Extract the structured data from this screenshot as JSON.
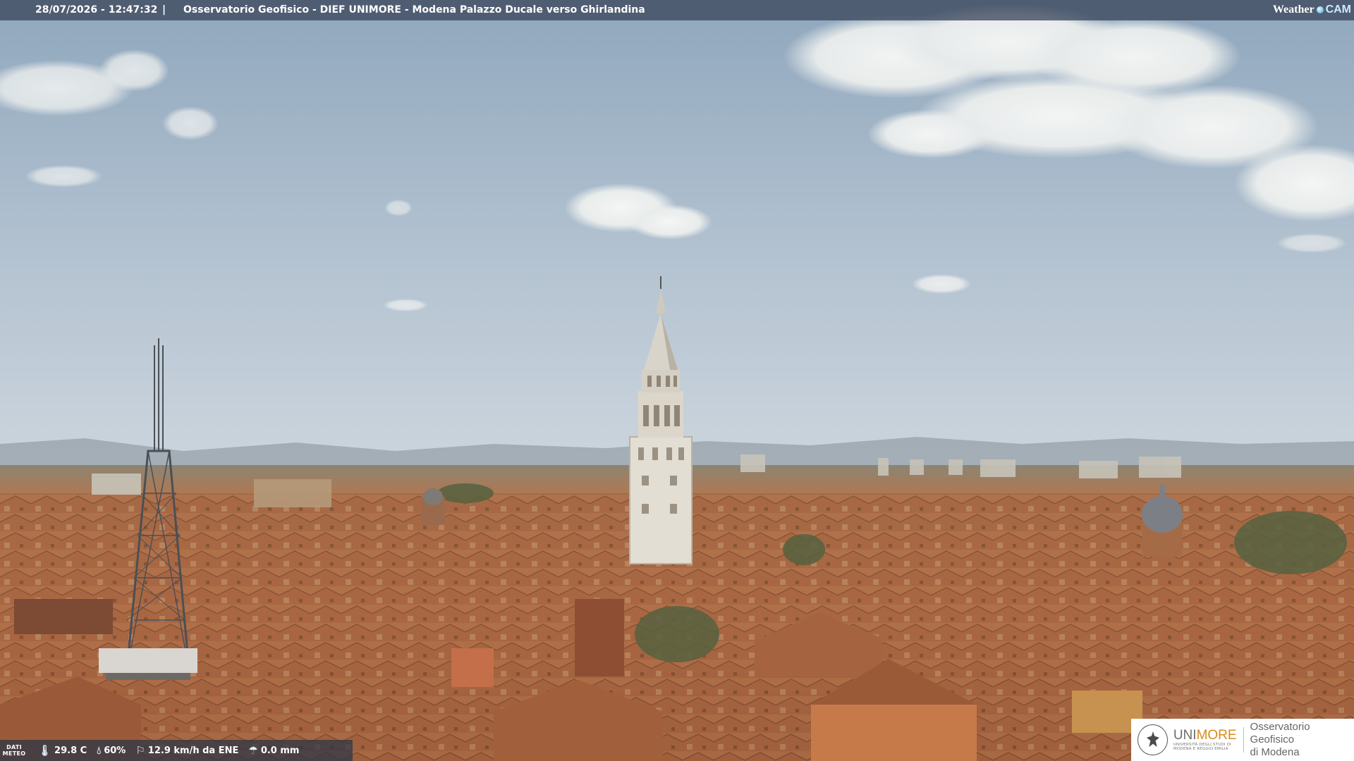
{
  "header": {
    "timestamp": "28/07/2026 - 12:47:32",
    "separator": "|",
    "location": "Osservatorio Geofisico - DIEF UNIMORE - Modena Palazzo Ducale verso Ghirlandina"
  },
  "brand": {
    "weather": "Weather",
    "cam": "CAM"
  },
  "meteo": {
    "label_line1": "DATI",
    "label_line2": "METEO",
    "temperature": "29.8 C",
    "humidity": "60%",
    "wind": "12.9 km/h da ENE",
    "rain": "0.0 mm"
  },
  "logo": {
    "uni_prefix": "UNI",
    "uni_suffix": "MORE",
    "uni_sub1": "UNIVERSITÀ DEGLI STUDI DI",
    "uni_sub2": "MODENA E REGGIO EMILIA",
    "observatory_line1": "Osservatorio Geofisico",
    "observatory_line2": "di Modena"
  },
  "icons": {
    "temperature": "thermometer-icon",
    "humidity": "drop-icon",
    "wind": "windsock-icon",
    "rain": "rain-gauge-icon"
  },
  "colors": {
    "sky_top": "#8ea6bd",
    "sky_bottom": "#c9d3dc",
    "roof": "#b5734a",
    "tower": "#e2ddd3"
  }
}
